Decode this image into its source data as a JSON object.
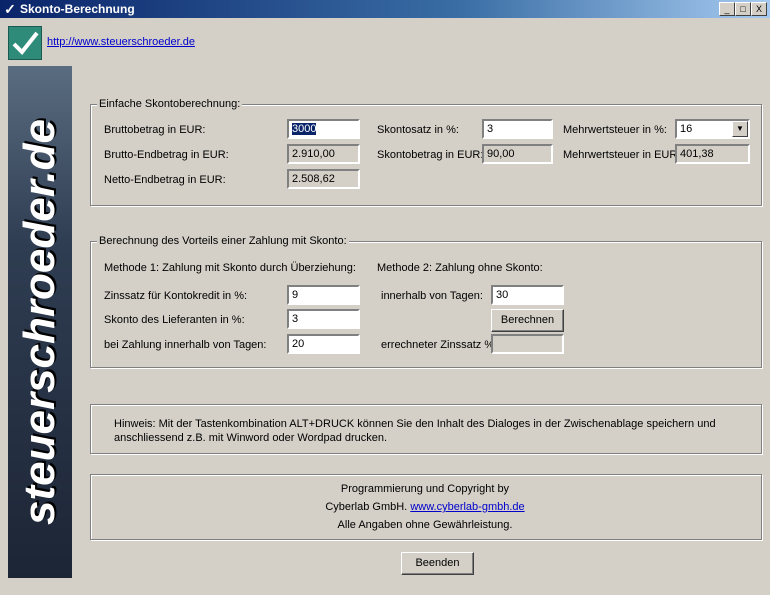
{
  "window": {
    "title": "Skonto-Berechnung",
    "controls": [
      "_",
      "□",
      "X"
    ]
  },
  "header": {
    "url": "http://www.steuerschroeder.de"
  },
  "sidebar": {
    "text": "steuerschroeder.de"
  },
  "group1": {
    "label": "Einfache Skontoberechnung:",
    "brutto_label": "Bruttobetrag in EUR:",
    "brutto_value": "3000",
    "skontosatz_label": "Skontosatz in %:",
    "skontosatz_value": "3",
    "mwst_label": "Mehrwertsteuer in %:",
    "mwst_value": "16",
    "brutto_end_label": "Brutto-Endbetrag in EUR:",
    "brutto_end_value": "2.910,00",
    "skontobetrag_label": "Skontobetrag in EUR:",
    "skontobetrag_value": "90,00",
    "mwst_eur_label": "Mehrwertsteuer in EUR:",
    "mwst_eur_value": "401,38",
    "netto_end_label": "Netto-Endbetrag in EUR:",
    "netto_end_value": "2.508,62"
  },
  "group2": {
    "label": "Berechnung des Vorteils einer Zahlung mit Skonto:",
    "method1_title": "Methode 1: Zahlung mit Skonto durch Überziehung:",
    "method2_title": "Methode 2: Zahlung ohne Skonto:",
    "zinssatz_label": "Zinssatz für Kontokredit in %:",
    "zinssatz_value": "9",
    "skonto_lief_label": "Skonto des Lieferanten in %:",
    "skonto_lief_value": "3",
    "tage_label": "bei Zahlung innerhalb von Tagen:",
    "tage_value": "20",
    "innerhalb_label": "innerhalb von Tagen:",
    "innerhalb_value": "30",
    "berechnen_label": "Berechnen",
    "errechneter_label": "errechneter Zinssatz %",
    "errechneter_value": ""
  },
  "hint": {
    "text": "Hinweis: Mit der Tastenkombination ALT+DRUCK können Sie den Inhalt des Dialoges in der Zwischenablage speichern und anschliessend z.B. mit Winword oder Wordpad drucken."
  },
  "copyright": {
    "line1": "Programmierung und Copyright by",
    "line2_prefix": "Cyberlab GmbH.",
    "line2_link": "www.cyberlab-gmbh.de",
    "line3": "Alle Angaben ohne Gewährleistung."
  },
  "footer": {
    "beenden_label": "Beenden"
  }
}
